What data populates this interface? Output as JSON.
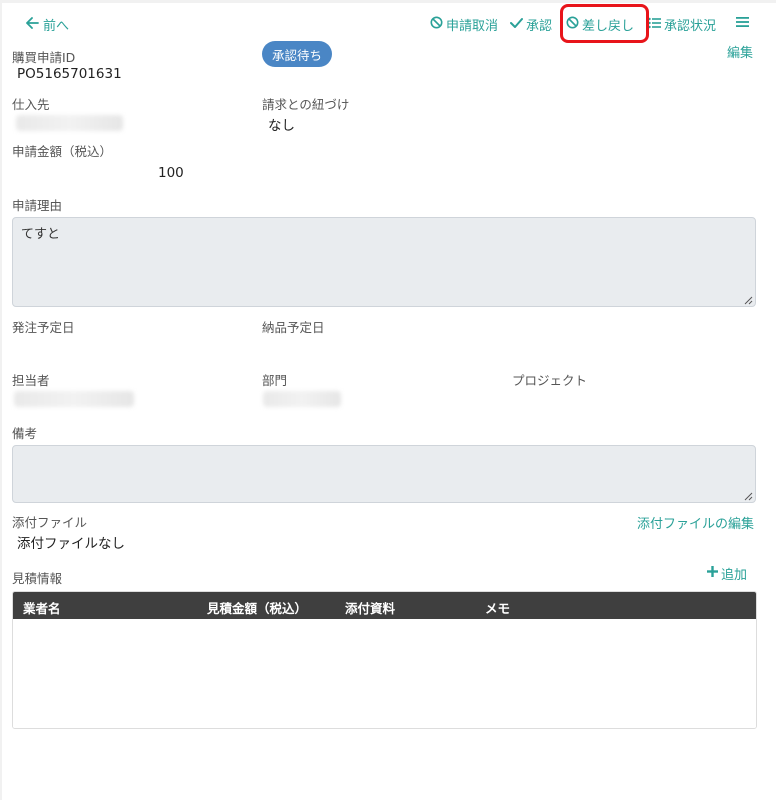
{
  "nav": {
    "back_label": "前へ"
  },
  "toolbar": {
    "cancel_label": "申請取消",
    "approve_label": "承認",
    "sendback_label": "差し戻し",
    "status_label": "承認状況"
  },
  "header": {
    "edit_label": "編集"
  },
  "fields": {
    "purchase_id_label": "購買申請ID",
    "purchase_id_value": "PO5165701631",
    "status_badge": "承認待ち",
    "supplier_label": "仕入先",
    "invoice_link_label": "請求との紐づけ",
    "invoice_link_value": "なし",
    "amount_label": "申請金額（税込）",
    "amount_value": "100",
    "reason_label": "申請理由",
    "reason_value": "てすと",
    "order_date_label": "発注予定日",
    "delivery_date_label": "納品予定日",
    "owner_label": "担当者",
    "department_label": "部門",
    "project_label": "プロジェクト",
    "notes_label": "備考",
    "attachments_label": "添付ファイル",
    "attachments_value": "添付ファイルなし",
    "attachments_edit_label": "添付ファイルの編集",
    "estimates_label": "見積情報",
    "add_label": "追加"
  },
  "estimates_table": {
    "columns": [
      "業者名",
      "見積金額（税込）",
      "添付資料",
      "メモ"
    ],
    "rows": []
  },
  "colors": {
    "accent": "#2aa198",
    "badge": "#4a86c5",
    "highlight": "#e8141a",
    "table_header": "#3f3f3f"
  }
}
